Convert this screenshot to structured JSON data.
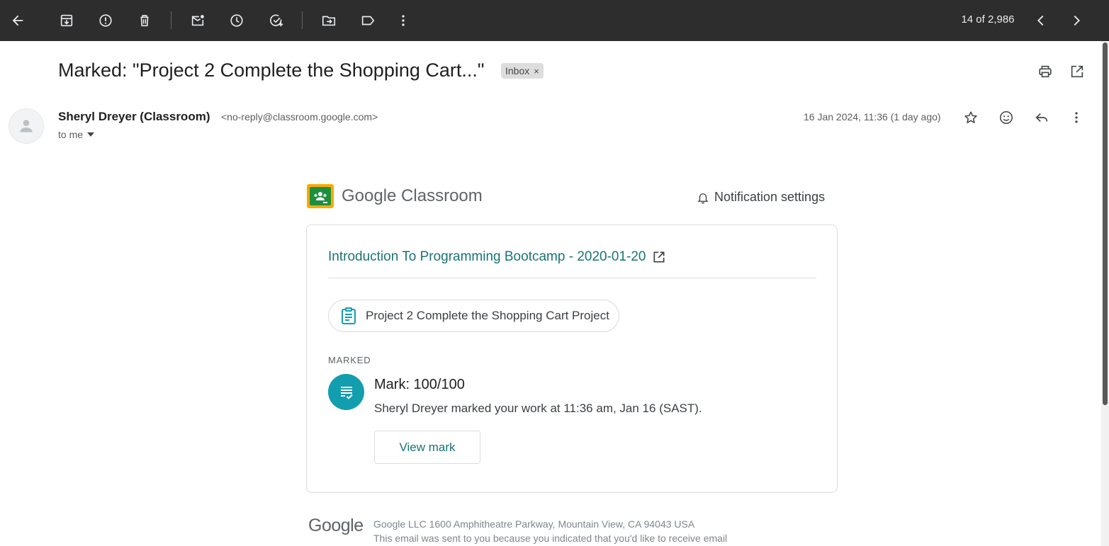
{
  "toolbar": {
    "buttons": [
      "back",
      "archive",
      "report-spam",
      "delete",
      "mark-unread",
      "snooze",
      "add-to-tasks",
      "move-to",
      "labels",
      "more"
    ],
    "count": "14 of 2,986"
  },
  "email": {
    "subject": "Marked: \"Project 2 Complete the Shopping Cart...\"",
    "label": "Inbox",
    "label_remove": "×",
    "sender_name": "Sheryl Dreyer (Classroom)",
    "sender_email": "<no-reply@classroom.google.com>",
    "recipient": "to me",
    "date": "16 Jan 2024, 11:36 (1 day ago)"
  },
  "classroom": {
    "brand_google": "Google",
    "brand_product": " Classroom",
    "notification_settings": "Notification settings",
    "course": "Introduction To Programming Bootcamp - 2020-01-20",
    "assignment": "Project 2 Complete the Shopping Cart Project",
    "status_label": "MARKED",
    "mark_title": "Mark: 100/100",
    "mark_desc": "Sheryl Dreyer marked your work at 11:36 am, Jan 16 (SAST).",
    "view_button": "View mark"
  },
  "footer": {
    "logo": "Google",
    "address": "Google LLC 1600 Amphitheatre Parkway, Mountain View, CA 94043 USA",
    "note": "This email was sent to you because you indicated that you'd like to receive email"
  },
  "colors": {
    "toolbar_bg": "#2d2d2d",
    "accent_teal": "#1a7373",
    "mark_icon": "#129eaf",
    "classroom_green": "#1e8e3e",
    "classroom_yellow": "#f9ab00"
  }
}
